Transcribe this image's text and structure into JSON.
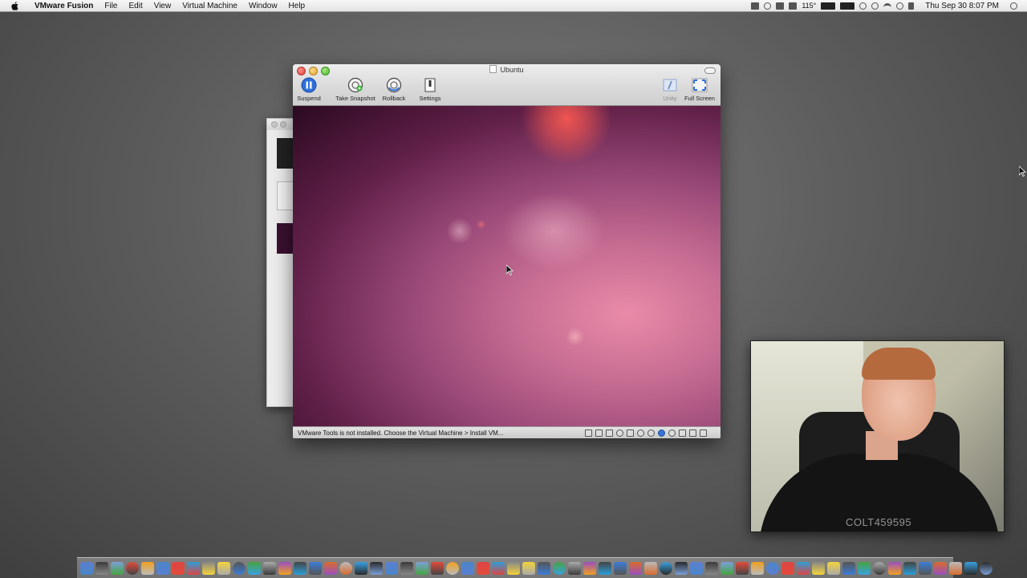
{
  "menubar": {
    "apple_icon": "apple-icon",
    "app_name": "VMware Fusion",
    "menus": [
      "File",
      "Edit",
      "View",
      "Virtual Machine",
      "Window",
      "Help"
    ],
    "status": {
      "temperature": "115°",
      "clock": "Thu Sep 30  8:07 PM",
      "icons": [
        "camera-icon",
        "cloud-icon",
        "display-icon",
        "monitor-icon",
        "temperature-icon",
        "battery-icon",
        "wifi-icon",
        "time-machine-icon",
        "volume-icon",
        "spotlight-icon"
      ]
    }
  },
  "vm_window": {
    "title": "Ubuntu",
    "toolbar": {
      "suspend": "Suspend",
      "take_snapshot": "Take Snapshot",
      "rollback": "Rollback",
      "settings": "Settings",
      "unity": "Unity",
      "full_screen": "Full Screen"
    },
    "status_message": "VMware Tools is not installed. Choose the Virtual Machine > Install VM..."
  },
  "webcam": {
    "watermark": "COLT459595"
  },
  "colors": {
    "accent_blue": "#3a73d6",
    "ubuntu_pink": "#e98aa8",
    "ubuntu_dark": "#2b0a21"
  },
  "dock": {
    "item_count": 60
  }
}
